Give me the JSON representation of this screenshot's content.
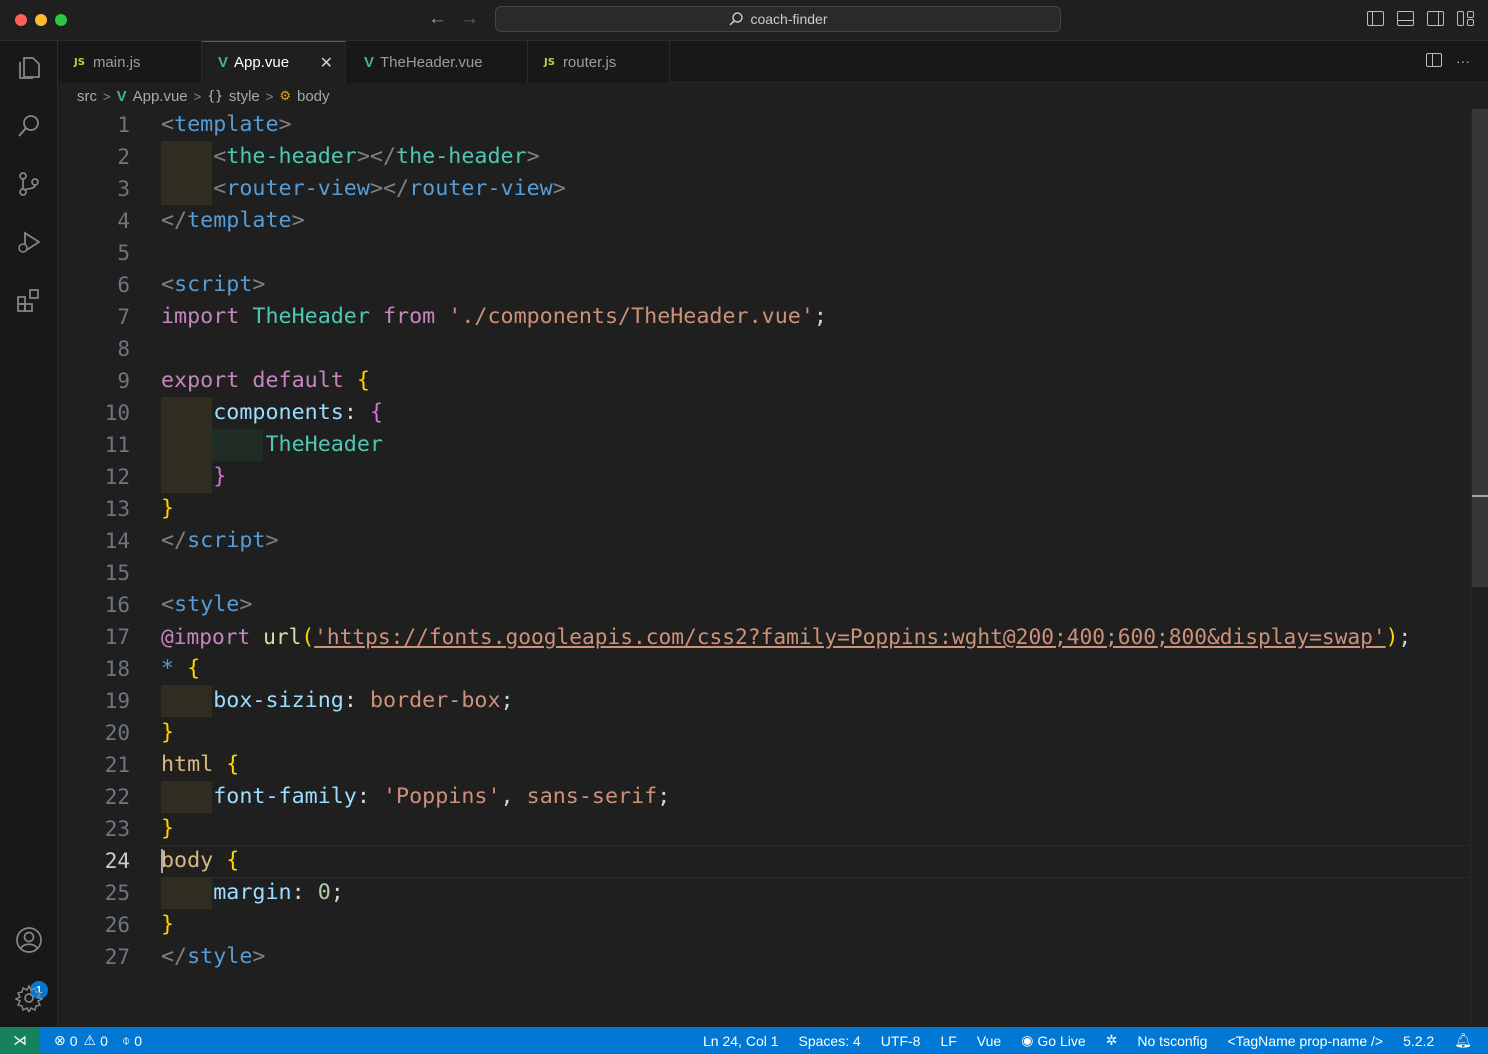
{
  "window": {
    "search_text": "coach-finder"
  },
  "tabs": [
    {
      "label": "main.js",
      "type": "js"
    },
    {
      "label": "App.vue",
      "type": "vue",
      "active": true
    },
    {
      "label": "TheHeader.vue",
      "type": "vue"
    },
    {
      "label": "router.js",
      "type": "js"
    }
  ],
  "breadcrumb": {
    "folder": "src",
    "file": "App.vue",
    "section": "style",
    "symbol": "body"
  },
  "editor": {
    "current_line": 24,
    "lines": [
      "1",
      "2",
      "3",
      "4",
      "5",
      "6",
      "7",
      "8",
      "9",
      "10",
      "11",
      "12",
      "13",
      "14",
      "15",
      "16",
      "17",
      "18",
      "19",
      "20",
      "21",
      "22",
      "23",
      "24",
      "25",
      "26",
      "27"
    ]
  },
  "status": {
    "errors": "0",
    "warnings": "0",
    "ports": "0",
    "position": "Ln 24, Col 1",
    "spaces": "Spaces: 4",
    "encoding": "UTF-8",
    "eol": "LF",
    "language": "Vue",
    "go_live": "Go Live",
    "tsconfig": "No tsconfig",
    "tag_format": "<TagName prop-name />",
    "version": "5.2.2"
  },
  "accounts_badge": "1",
  "colors": {
    "accent": "#0078d4",
    "status_bar": "#0078d4",
    "remote": "#16825d"
  }
}
